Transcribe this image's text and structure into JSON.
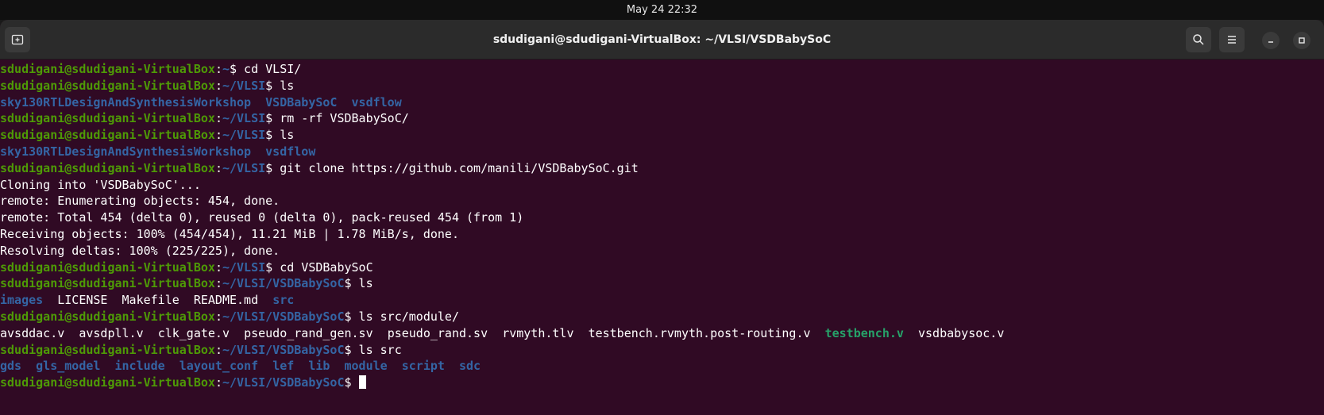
{
  "system": {
    "clock": "May 24  22:32"
  },
  "window": {
    "title": "sdudigani@sdudigani-VirtualBox: ~/VLSI/VSDBabySoC"
  },
  "terminal": {
    "lines": [
      {
        "type": "cmd",
        "user": "sdudigani@sdudigani-VirtualBox",
        "path": "~",
        "command": " cd VLSI/"
      },
      {
        "type": "cmd",
        "user": "sdudigani@sdudigani-VirtualBox",
        "path": "~/VLSI",
        "command": " ls"
      },
      {
        "type": "ls",
        "items": [
          {
            "text": "sky130RTLDesignAndSynthesisWorkshop",
            "kind": "dir"
          },
          {
            "text": "VSDBabySoC",
            "kind": "dir"
          },
          {
            "text": "vsdflow",
            "kind": "dir"
          }
        ]
      },
      {
        "type": "cmd",
        "user": "sdudigani@sdudigani-VirtualBox",
        "path": "~/VLSI",
        "command": " rm -rf VSDBabySoC/"
      },
      {
        "type": "cmd",
        "user": "sdudigani@sdudigani-VirtualBox",
        "path": "~/VLSI",
        "command": " ls"
      },
      {
        "type": "ls",
        "items": [
          {
            "text": "sky130RTLDesignAndSynthesisWorkshop",
            "kind": "dir"
          },
          {
            "text": "vsdflow",
            "kind": "dir"
          }
        ]
      },
      {
        "type": "cmd",
        "user": "sdudigani@sdudigani-VirtualBox",
        "path": "~/VLSI",
        "command": " git clone https://github.com/manili/VSDBabySoC.git"
      },
      {
        "type": "out",
        "text": "Cloning into 'VSDBabySoC'..."
      },
      {
        "type": "out",
        "text": "remote: Enumerating objects: 454, done."
      },
      {
        "type": "out",
        "text": "remote: Total 454 (delta 0), reused 0 (delta 0), pack-reused 454 (from 1)"
      },
      {
        "type": "out",
        "text": "Receiving objects: 100% (454/454), 11.21 MiB | 1.78 MiB/s, done."
      },
      {
        "type": "out",
        "text": "Resolving deltas: 100% (225/225), done."
      },
      {
        "type": "cmd",
        "user": "sdudigani@sdudigani-VirtualBox",
        "path": "~/VLSI",
        "command": " cd VSDBabySoC"
      },
      {
        "type": "cmd",
        "user": "sdudigani@sdudigani-VirtualBox",
        "path": "~/VLSI/VSDBabySoC",
        "command": " ls"
      },
      {
        "type": "ls",
        "items": [
          {
            "text": "images",
            "kind": "dir"
          },
          {
            "text": "LICENSE",
            "kind": "file"
          },
          {
            "text": "Makefile",
            "kind": "file"
          },
          {
            "text": "README.md",
            "kind": "file"
          },
          {
            "text": "src",
            "kind": "dir"
          }
        ]
      },
      {
        "type": "cmd",
        "user": "sdudigani@sdudigani-VirtualBox",
        "path": "~/VLSI/VSDBabySoC",
        "command": " ls src/module/"
      },
      {
        "type": "ls",
        "items": [
          {
            "text": "avsddac.v",
            "kind": "file"
          },
          {
            "text": "avsdpll.v",
            "kind": "file"
          },
          {
            "text": "clk_gate.v",
            "kind": "file"
          },
          {
            "text": "pseudo_rand_gen.sv",
            "kind": "file"
          },
          {
            "text": "pseudo_rand.sv",
            "kind": "file"
          },
          {
            "text": "rvmyth.tlv",
            "kind": "file"
          },
          {
            "text": "testbench.rvmyth.post-routing.v",
            "kind": "file"
          },
          {
            "text": "testbench.v",
            "kind": "exe"
          },
          {
            "text": "vsdbabysoc.v",
            "kind": "file"
          }
        ]
      },
      {
        "type": "cmd",
        "user": "sdudigani@sdudigani-VirtualBox",
        "path": "~/VLSI/VSDBabySoC",
        "command": " ls src"
      },
      {
        "type": "ls",
        "items": [
          {
            "text": "gds",
            "kind": "dir"
          },
          {
            "text": "gls_model",
            "kind": "dir"
          },
          {
            "text": "include",
            "kind": "dir"
          },
          {
            "text": "layout_conf",
            "kind": "dir"
          },
          {
            "text": "lef",
            "kind": "dir"
          },
          {
            "text": "lib",
            "kind": "dir"
          },
          {
            "text": "module",
            "kind": "dir"
          },
          {
            "text": "script",
            "kind": "dir"
          },
          {
            "text": "sdc",
            "kind": "dir"
          }
        ]
      },
      {
        "type": "prompt",
        "user": "sdudigani@sdudigani-VirtualBox",
        "path": "~/VLSI/VSDBabySoC",
        "command": " "
      }
    ]
  }
}
